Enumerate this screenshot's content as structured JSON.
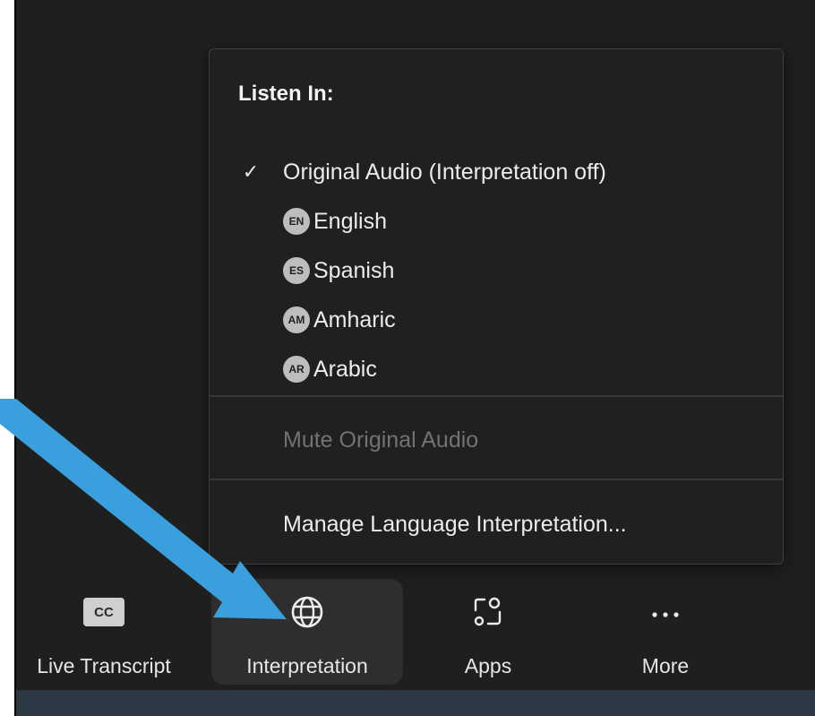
{
  "menu": {
    "heading": "Listen In:",
    "original_audio": {
      "label": "Original Audio (Interpretation off)",
      "checked": true,
      "check_glyph": "✓"
    },
    "languages": [
      {
        "code": "EN",
        "label": "English"
      },
      {
        "code": "ES",
        "label": "Spanish"
      },
      {
        "code": "AM",
        "label": "Amharic"
      },
      {
        "code": "AR",
        "label": "Arabic"
      }
    ],
    "mute_original": {
      "label": "Mute Original Audio",
      "enabled": false
    },
    "manage": {
      "label": "Manage Language Interpretation..."
    }
  },
  "toolbar": {
    "live_transcript": {
      "label": "Live Transcript",
      "icon": "cc-icon",
      "icon_text": "CC"
    },
    "interpretation": {
      "label": "Interpretation",
      "icon": "globe-icon",
      "active": true
    },
    "apps": {
      "label": "Apps",
      "icon": "apps-icon"
    },
    "more": {
      "label": "More",
      "icon": "ellipsis-icon"
    }
  },
  "colors": {
    "annotation_arrow": "#3aa0dd",
    "menu_bg": "#202020",
    "app_bg": "#1f1f1f"
  }
}
